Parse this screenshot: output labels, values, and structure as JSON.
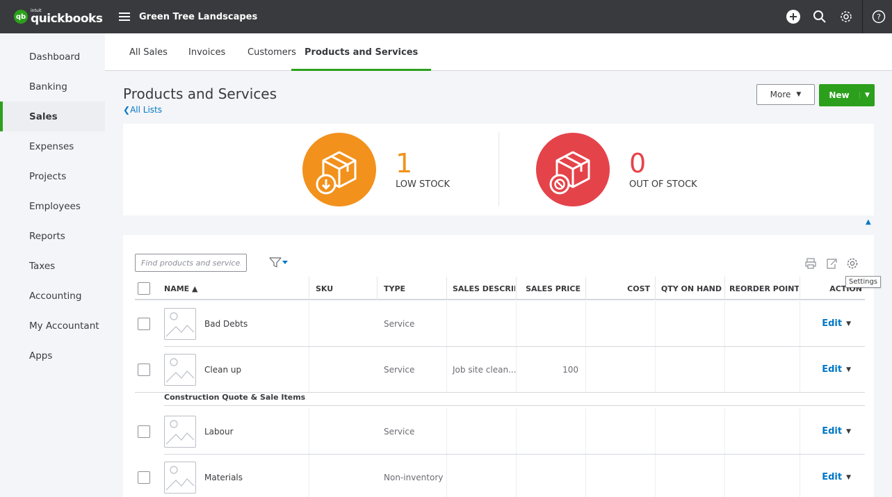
{
  "app": {
    "logo_small": "intuit",
    "logo_name": "quickbooks",
    "company": "Green Tree Landscapes"
  },
  "topbar": {
    "icons": [
      "plus-circle-icon",
      "search-icon",
      "gear-icon",
      "help-icon"
    ]
  },
  "sidebar": {
    "items": [
      {
        "label": "Dashboard"
      },
      {
        "label": "Banking"
      },
      {
        "label": "Sales",
        "active": true
      },
      {
        "label": "Expenses"
      },
      {
        "label": "Projects"
      },
      {
        "label": "Employees"
      },
      {
        "label": "Reports"
      },
      {
        "label": "Taxes"
      },
      {
        "label": "Accounting"
      },
      {
        "label": "My Accountant"
      },
      {
        "label": "Apps"
      }
    ]
  },
  "subtabs": [
    {
      "label": "All Sales"
    },
    {
      "label": "Invoices"
    },
    {
      "label": "Customers"
    },
    {
      "label": "Products and Services",
      "active": true
    }
  ],
  "page": {
    "title": "Products and Services",
    "back_link": "All Lists",
    "more_label": "More",
    "new_label": "New"
  },
  "stock": {
    "low": {
      "count": "1",
      "label": "LOW STOCK",
      "color": "#f2911b"
    },
    "out": {
      "count": "0",
      "label": "OUT OF STOCK",
      "color": "#e5434a"
    }
  },
  "table": {
    "search_placeholder": "Find products and services",
    "tooltip": "Settings",
    "columns": {
      "name": "NAME ▲",
      "sku": "SKU",
      "type": "TYPE",
      "sales_description": "SALES DESCRIPTI",
      "sales_price": "SALES PRICE",
      "cost": "COST",
      "qty_on_hand": "QTY ON HAND",
      "reorder_point": "REORDER POINT",
      "action": "ACTION"
    },
    "rows": [
      {
        "name": "Bad Debts",
        "type": "Service",
        "sales_description": "",
        "sales_price": "",
        "action": "Edit"
      },
      {
        "name": "Clean up",
        "type": "Service",
        "sales_description": "Job site clean...",
        "sales_price": "100",
        "action": "Edit"
      },
      {
        "name": "Labour",
        "type": "Service",
        "sales_description": "",
        "sales_price": "",
        "action": "Edit"
      },
      {
        "name": "Materials",
        "type": "Non-inventory",
        "sales_description": "",
        "sales_price": "",
        "action": "Edit"
      }
    ],
    "group_label": "Construction Quote & Sale Items"
  },
  "colors": {
    "brand_green": "#2ca01c",
    "topbar": "#393a3d",
    "link_blue": "#0077c5"
  }
}
